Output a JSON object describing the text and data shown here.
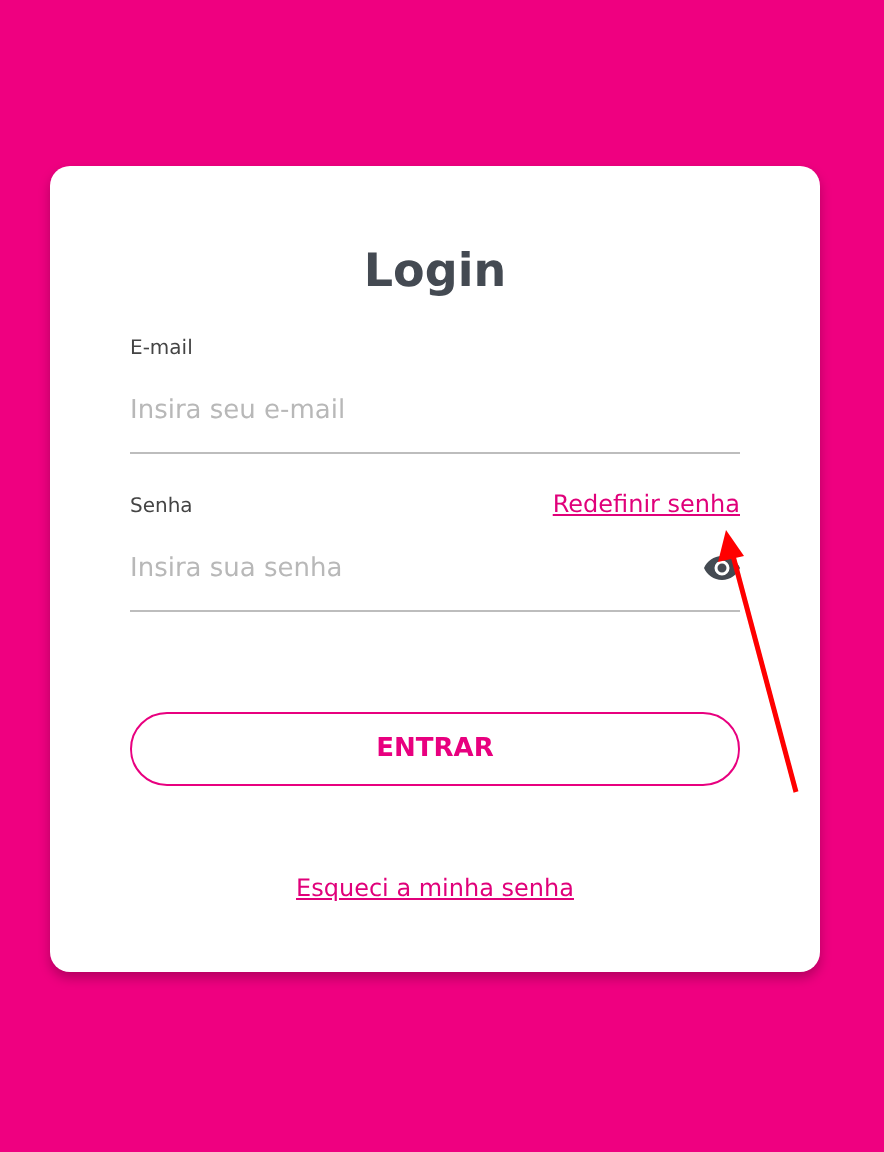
{
  "title": "Login",
  "fields": [
    {
      "label": "E-mail",
      "placeholder": "Insira seu e-mail"
    },
    {
      "label": "Senha",
      "placeholder": "Insira sua senha",
      "link": "Redefinir senha",
      "reveal_icon": true
    }
  ],
  "submit": "ENTRAR",
  "footer_link": "Esqueci a minha senha"
}
